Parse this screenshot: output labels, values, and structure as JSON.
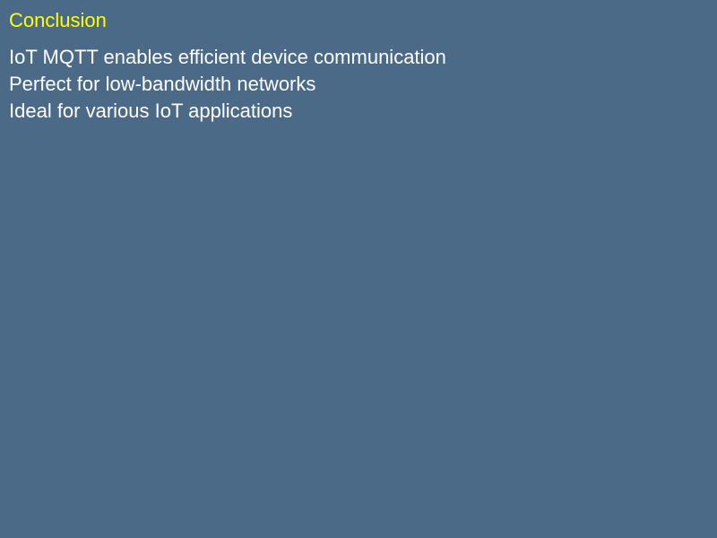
{
  "slide": {
    "title": "Conclusion",
    "bullets": [
      "IoT MQTT enables efficient device communication",
      "Perfect for low-bandwidth networks",
      "Ideal for various IoT applications"
    ]
  },
  "colors": {
    "background": "#4a6a88",
    "title": "#ffff00",
    "text": "#ffffff"
  }
}
